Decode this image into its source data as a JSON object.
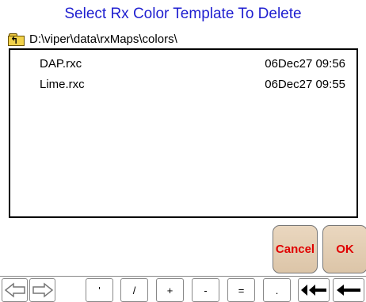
{
  "dialog": {
    "title": "Select Rx Color Template To Delete",
    "path": "D:\\viper\\data\\rxMaps\\colors\\"
  },
  "files": [
    {
      "name": "DAP.rxc",
      "date": "06Dec27 09:56"
    },
    {
      "name": "Lime.rxc",
      "date": "06Dec27 09:55"
    }
  ],
  "buttons": {
    "cancel": "Cancel",
    "ok": "OK"
  },
  "keyboard": {
    "keys": [
      "'",
      "/",
      "+",
      "-",
      "=",
      "."
    ],
    "icons": [
      "arrow-left-outline-icon",
      "arrow-right-outline-icon",
      "double-backspace-icon",
      "backspace-icon"
    ]
  },
  "colors": {
    "title": "#1f1fd0",
    "button_text": "#e00000",
    "button_bg": "#e2cdb3"
  }
}
